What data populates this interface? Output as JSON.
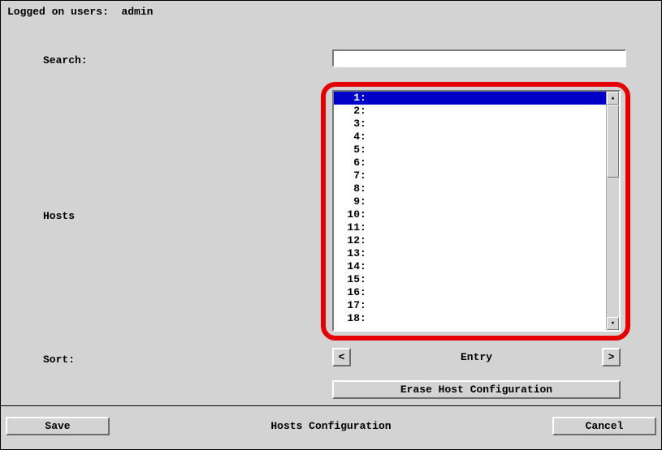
{
  "status": {
    "logged_on_prefix": "Logged on users:",
    "user": "admin"
  },
  "labels": {
    "search": "Search:",
    "hosts": "Hosts",
    "sort": "Sort:"
  },
  "search": {
    "value": ""
  },
  "hosts_list": {
    "selected_index": 0,
    "items": [
      {
        "num": "1",
        "value": ""
      },
      {
        "num": "2",
        "value": ""
      },
      {
        "num": "3",
        "value": ""
      },
      {
        "num": "4",
        "value": ""
      },
      {
        "num": "5",
        "value": ""
      },
      {
        "num": "6",
        "value": ""
      },
      {
        "num": "7",
        "value": ""
      },
      {
        "num": "8",
        "value": ""
      },
      {
        "num": "9",
        "value": ""
      },
      {
        "num": "10",
        "value": ""
      },
      {
        "num": "11",
        "value": ""
      },
      {
        "num": "12",
        "value": ""
      },
      {
        "num": "13",
        "value": ""
      },
      {
        "num": "14",
        "value": ""
      },
      {
        "num": "15",
        "value": ""
      },
      {
        "num": "16",
        "value": ""
      },
      {
        "num": "17",
        "value": ""
      },
      {
        "num": "18",
        "value": ""
      }
    ]
  },
  "sort": {
    "current": "Entry",
    "prev_glyph": "<",
    "next_glyph": ">"
  },
  "buttons": {
    "erase": "Erase Host Configuration",
    "save": "Save",
    "cancel": "Cancel"
  },
  "footer_title": "Hosts Configuration",
  "glyphs": {
    "up": "▴",
    "down": "▾"
  }
}
